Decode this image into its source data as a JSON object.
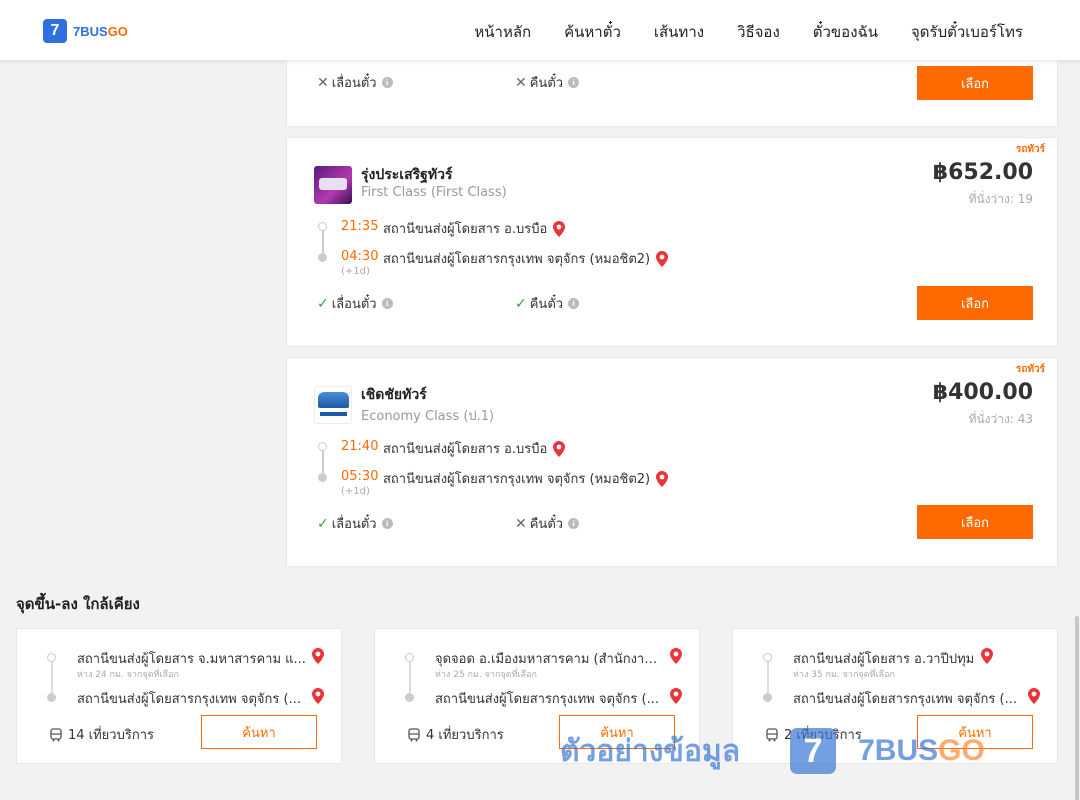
{
  "header": {
    "logo_mark": "7",
    "logo_text_a": "7BUS",
    "logo_text_b": "GO",
    "nav": [
      "หน้าหลัก",
      "ค้นหาตั๋ว",
      "เส้นทาง",
      "วิธีจอง",
      "ตั๋วของฉัน",
      "จุดรับตั๋วเบอร์โทร"
    ]
  },
  "trips": [
    {
      "refund_label": "เลื่อนตั๋ว",
      "refund_icon": "cross-icon",
      "cancel_label": "คืนตั๋ว",
      "cancel_icon": "cross-icon",
      "select_label": "เลือก"
    },
    {
      "tag": "รถทัวร์",
      "operator": "รุ่งประเสริฐทัวร์",
      "bus_class": "First Class (First Class)",
      "price": "฿652.00",
      "seats": "ที่นั่งว่าง: 19",
      "dep_time": "21:35",
      "dep_station": "สถานีขนส่งผู้โดยสาร อ.บรบือ",
      "arr_time": "04:30",
      "arr_station": "สถานีขนส่งผู้โดยสารกรุงเทพ จตุจักร (หมอชิต2)",
      "next_day": "(+1d)",
      "refund_label": "เลื่อนตั๋ว",
      "refund_icon": "check-icon",
      "cancel_label": "คืนตั๋ว",
      "cancel_icon": "check-icon",
      "select_label": "เลือก"
    },
    {
      "tag": "รถทัวร์",
      "operator": "เชิดชัยทัวร์",
      "bus_class": "Economy Class (ป.1)",
      "price": "฿400.00",
      "seats": "ที่นั่งว่าง: 43",
      "dep_time": "21:40",
      "dep_station": "สถานีขนส่งผู้โดยสาร อ.บรบือ",
      "arr_time": "05:30",
      "arr_station": "สถานีขนส่งผู้โดยสารกรุงเทพ จตุจักร (หมอชิต2)",
      "next_day": "(+1d)",
      "refund_label": "เลื่อนตั๋ว",
      "refund_icon": "check-icon",
      "cancel_label": "คืนตั๋ว",
      "cancel_icon": "cross-icon",
      "select_label": "เลือก"
    }
  ],
  "nearby": {
    "title": "จุดขึ้น-ลง ใกล้เคียง",
    "items": [
      {
        "from": "สถานีขนส่งผู้โดยสาร จ.มหาสารคาม แ...",
        "distance": "ห่าง 24 กม. จากจุดที่เลือก",
        "to": "สถานีขนส่งผู้โดยสารกรุงเทพ จตุจักร (...",
        "trips": "14 เที่ยวบริการ",
        "search_label": "ค้นหา"
      },
      {
        "from": "จุดจอด อ.เมืองมหาสารคาม (สำนักงาน...",
        "distance": "ห่าง 25 กม. จากจุดที่เลือก",
        "to": "สถานีขนส่งผู้โดยสารกรุงเทพ จตุจักร (...",
        "trips": "4 เที่ยวบริการ",
        "search_label": "ค้นหา"
      },
      {
        "from": "สถานีขนส่งผู้โดยสาร อ.วาปีปทุม",
        "distance": "ห่าง 35 กม. จากจุดที่เลือก",
        "to": "สถานีขนส่งผู้โดยสารกรุงเทพ จตุจักร (...",
        "trips": "2 เที่ยวบริการ",
        "search_label": "ค้นหา"
      }
    ]
  },
  "watermark": {
    "text": "ตัวอย่างข้อมูล",
    "logo_mark": "7",
    "brand_a": "7BUS",
    "brand_b": "GO"
  },
  "colors": {
    "accent": "#ff6a00",
    "brand_blue": "#2f6fe0",
    "ok_green": "#3aa33a"
  }
}
